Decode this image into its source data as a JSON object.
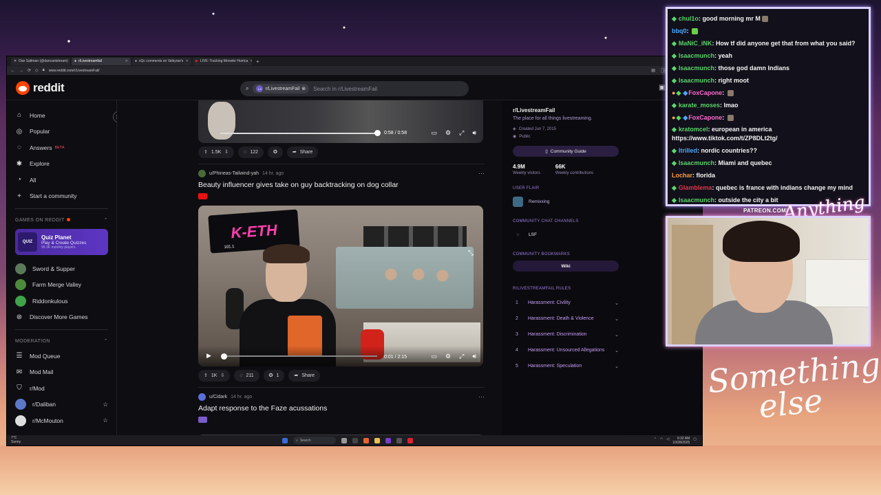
{
  "browser": {
    "tabs": [
      {
        "label": "Dan Saltman (@dancantstream)"
      },
      {
        "label": "r/Livestreamfail",
        "active": true
      },
      {
        "label": "xQc comments on Valkyrae's"
      },
      {
        "label": "LIVE: Tracking Monster Hurrica"
      }
    ],
    "url": "www.reddit.com/r/LivestreamFail/",
    "zoom": "150%"
  },
  "header": {
    "logo_text": "reddit",
    "search_chip": "r/LivestreamFail",
    "search_chip_avatar": "LS",
    "search_placeholder": "Search in r/LivestreamFail"
  },
  "sidebar": {
    "items": [
      {
        "label": "Home",
        "icon": "home-icon"
      },
      {
        "label": "Popular",
        "icon": "popular-icon"
      },
      {
        "label": "Answers",
        "icon": "answers-icon",
        "badge": "BETA"
      },
      {
        "label": "Explore",
        "icon": "explore-icon"
      },
      {
        "label": "All",
        "icon": "all-icon"
      },
      {
        "label": "Start a community",
        "icon": "plus-icon"
      }
    ],
    "games_header": "GAMES ON REDDIT",
    "quiz": {
      "img": "QUIZ",
      "title": "Quiz Planet",
      "subtitle": "Play & Create Quizzes",
      "meta": "99.3K monthly players"
    },
    "games": [
      {
        "label": "Sword & Supper"
      },
      {
        "label": "Farm Merge Valley"
      },
      {
        "label": "Riddonkulous"
      },
      {
        "label": "Discover More Games"
      }
    ],
    "moderation_header": "MODERATION",
    "mod_items": [
      {
        "label": "Mod Queue"
      },
      {
        "label": "Mod Mail"
      },
      {
        "label": "r/Mod"
      },
      {
        "label": "r/Daliban"
      },
      {
        "label": "r/McMouton"
      }
    ]
  },
  "feed": {
    "top_video": {
      "time": "0:58 / 0:58"
    },
    "top_actions": {
      "votes": "1.5K",
      "comments": "122",
      "share": "Share"
    },
    "post1": {
      "author": "u/Phineas-Tailwind-yah",
      "time": "14 hr. ago",
      "title": "Beauty influencer gives take on guy backtracking on dog collar",
      "video_logo": "K-ETH",
      "video_logo_sub": "101.1",
      "video_time": "0:01 / 2:15",
      "votes": "1K",
      "comments": "211",
      "awards": "1",
      "share": "Share"
    },
    "post2": {
      "author": "u/Cidark",
      "time": "14 hr. ago",
      "title": "Adapt response to the Faze acussations"
    }
  },
  "community": {
    "name": "r/LivestreamFail",
    "description": "The place for all things livestreaming.",
    "created": "Created Jun 7, 2015",
    "visibility": "Public",
    "guide_button": "Community Guide",
    "visitors_value": "4.9M",
    "visitors_label": "Weekly visitors",
    "contrib_value": "66K",
    "contrib_label": "Weekly contributions",
    "user_flair_header": "USER FLAIR",
    "user_flair": "Remixxing",
    "chat_header": "COMMUNITY CHAT CHANNELS",
    "chat_channel": "LSF",
    "bookmarks_header": "COMMUNITY BOOKMARKS",
    "wiki": "Wiki",
    "rules_header": "R/LIVESTREAMFAIL RULES",
    "rules": [
      {
        "num": "1",
        "text": "Harassment: Civility"
      },
      {
        "num": "2",
        "text": "Harassment: Death & Violence"
      },
      {
        "num": "3",
        "text": "Harassment: Discrimination"
      },
      {
        "num": "4",
        "text": "Harassment: Unsourced Allegations"
      },
      {
        "num": "5",
        "text": "Harassment: Speculation"
      }
    ]
  },
  "taskbar": {
    "search": "Search",
    "weather_temp": "7°C",
    "weather_desc": "Sunny",
    "clock_time": "9:32 AM",
    "clock_date": "10/28/2025"
  },
  "chat": {
    "messages": [
      {
        "user": "chul1o",
        "text": "good morning mr M",
        "color": "u-green"
      },
      {
        "user": "bbq0",
        "text": "",
        "color": "u-blue"
      },
      {
        "user": "MaNiC_iNK",
        "text": "How tf did anyone get that from what you said?",
        "color": "u-green"
      },
      {
        "user": "Isaacmunch",
        "text": "yeah",
        "color": "u-green"
      },
      {
        "user": "Isaacmunch",
        "text": "those god damn Indians",
        "color": "u-green"
      },
      {
        "user": "Isaacmunch",
        "text": "right moot",
        "color": "u-green"
      },
      {
        "user": "FoxCapone",
        "text": "",
        "color": "u-pink"
      },
      {
        "user": "karate_moses",
        "text": "lmao",
        "color": "u-green"
      },
      {
        "user": "FoxCapone",
        "text": "",
        "color": "u-pink"
      },
      {
        "user": "kratomcel",
        "text": "european in america https://www.tiktok.com/t/ZP8DLt2tg/",
        "color": "u-green"
      },
      {
        "user": "Itrilled",
        "text": "nordic countries??",
        "color": "u-blue"
      },
      {
        "user": "Isaacmunch",
        "text": "Miami and quebec",
        "color": "u-green"
      },
      {
        "user": "Lochar",
        "text": "florida",
        "color": "u-orange"
      },
      {
        "user": "Glamblema",
        "text": "quebec is france with indians change my mind",
        "color": "u-red"
      },
      {
        "user": "Isaacmunch",
        "text": "outside the city a bit",
        "color": "u-green"
      }
    ]
  },
  "overlay": {
    "patreon": "PATREON.COM/",
    "signature_small": "Anything else",
    "signature_large_1": "Something",
    "signature_large_2": "else"
  }
}
